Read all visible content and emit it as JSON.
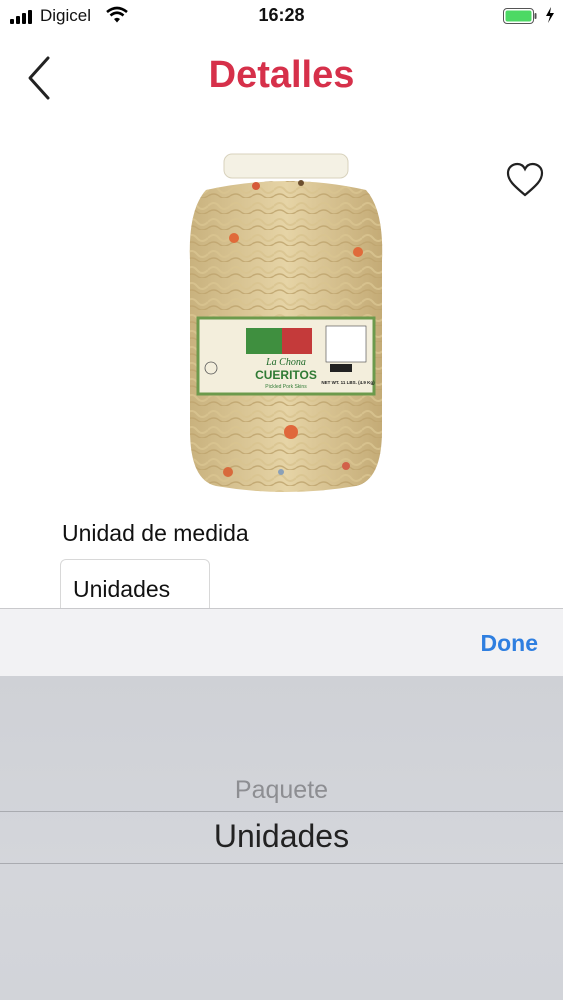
{
  "status_bar": {
    "carrier": "Digicel",
    "time": "16:28"
  },
  "header": {
    "title": "Detalles"
  },
  "product": {
    "label_brand": "La Chona",
    "label_name": "CUERITOS",
    "label_subtitle": "Pickled Pork Skins",
    "label_weight": "NET WT. 11 LBS. (4.9 Kg)"
  },
  "form": {
    "unit_label": "Unidad de medida",
    "unit_value": "Unidades"
  },
  "picker": {
    "done_label": "Done",
    "options": [
      "Paquete",
      "Unidades"
    ],
    "selected": "Unidades"
  },
  "colors": {
    "title": "#d6304a",
    "done": "#2f7fe0"
  },
  "icons": {
    "back": "chevron-left-icon",
    "favorite": "heart-icon"
  }
}
